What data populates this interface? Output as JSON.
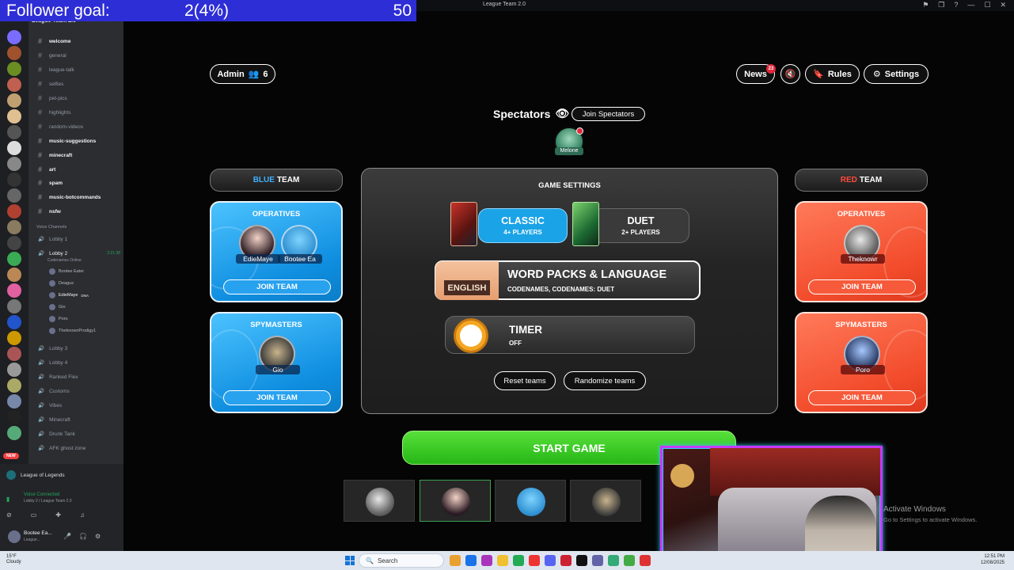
{
  "follower_goal": {
    "label": "Follower goal:",
    "progress": "2(4%)",
    "target": "50"
  },
  "window": {
    "title": "League Team 2.0"
  },
  "discord": {
    "server_title": "League Team 2.0",
    "channels": [
      "welcome",
      "general",
      "league-talk",
      "selfies",
      "pet-pics",
      "highlights",
      "random-videos",
      "music-suggestions",
      "minecraft",
      "art",
      "spam",
      "music-botcommands",
      "nsfw"
    ],
    "voice_category": "Voice Channels",
    "voice_channels": {
      "lobby1": "Lobby 1",
      "lobby2": "Lobby 2",
      "lobby2_sub": "Codenames Online",
      "lobby2_time": "2:21:38",
      "members": [
        "Bootee Eater",
        "Deagus",
        "EdieMaye",
        "Gio",
        "Poro",
        "TheknownProdigy1"
      ],
      "edie_tag": "DNA",
      "others": [
        "Lobby 3",
        "Lobby 4",
        "Ranked Flex",
        "Customs",
        "Vibes",
        "Minecraft",
        "Drunk Tank",
        "AFK ghost zone"
      ]
    },
    "new_badge": "NEW",
    "bottom_server": "League of Legends",
    "voice_connected": "Voice Connected",
    "voice_location": "Lobby 2 / League Team 2.0",
    "user_name": "Bootee Ea...",
    "user_status": "League..."
  },
  "game": {
    "admin_label": "Admin",
    "admin_count": "6",
    "news_label": "News",
    "news_badge": "23",
    "rules_label": "Rules",
    "settings_label": "Settings",
    "spectators_label": "Spectators",
    "join_spectators": "Join Spectators",
    "spectator_name": "Melone",
    "blue_team": {
      "color_word": "BLUE",
      "team_word": "TEAM",
      "operatives_title": "OPERATIVES",
      "operatives": [
        "EdieMaye",
        "Bootee Ea"
      ],
      "spymasters_title": "SPYMASTERS",
      "spymasters": [
        "Gio"
      ],
      "join": "JOIN TEAM"
    },
    "red_team": {
      "color_word": "RED",
      "team_word": "TEAM",
      "operatives_title": "OPERATIVES",
      "operatives": [
        "Theknowr"
      ],
      "spymasters_title": "SPYMASTERS",
      "spymasters": [
        "Poro"
      ],
      "join": "JOIN TEAM"
    },
    "settings_panel": {
      "title": "GAME SETTINGS",
      "classic_title": "CLASSIC",
      "classic_sub": "4+ PLAYERS",
      "duet_title": "DUET",
      "duet_sub": "2+ PLAYERS",
      "language_badge": "ENGLISH",
      "wordpacks_title": "WORD PACKS & LANGUAGE",
      "wordpacks_sub": "CODENAMES, CODENAMES: DUET",
      "timer_title": "TIMER",
      "timer_value": "OFF",
      "reset_label": "Reset teams",
      "randomize_label": "Randomize teams"
    },
    "start_label": "START GAME",
    "activate_title": "Activate Windows",
    "activate_sub": "Go to Settings to activate Windows."
  },
  "taskbar": {
    "weather_temp": "15°F",
    "weather_desc": "Cloudy",
    "search_placeholder": "Search",
    "time": "12:51 PM",
    "date": "12/08/2025"
  },
  "colors": {
    "blue_team": "#1a9ee8",
    "red_team": "#f24c2c",
    "start_green": "#3ccc22",
    "goal_bar": "#2e2ed6"
  }
}
